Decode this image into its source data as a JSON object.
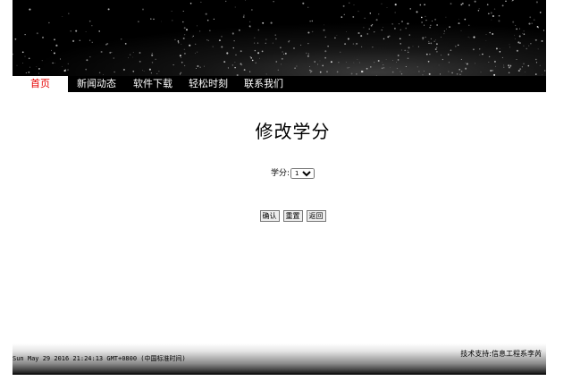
{
  "nav": {
    "items": [
      {
        "label": "首页",
        "active": true
      },
      {
        "label": "新闻动态",
        "active": false
      },
      {
        "label": "软件下载",
        "active": false
      },
      {
        "label": "轻松时刻",
        "active": false
      },
      {
        "label": "联系我们",
        "active": false
      }
    ]
  },
  "main": {
    "title": "修改学分",
    "credit_label": "学分:",
    "credit_select": {
      "selected": "1"
    },
    "buttons": {
      "confirm": "确认",
      "reset": "重置",
      "back": "返回"
    }
  },
  "footer": {
    "support_text": "技术支持:信息工程系李芮",
    "datetime": "Sun May 29 2016 21:24:13 GMT+0800 (中国标准时间)"
  },
  "colors": {
    "nav_active_text": "#e60000",
    "nav_bg": "#000000",
    "banner_bg": "#000000"
  },
  "icons": {
    "banner": "sparkle-banner-image",
    "select_arrow": "chevron-down-icon"
  }
}
